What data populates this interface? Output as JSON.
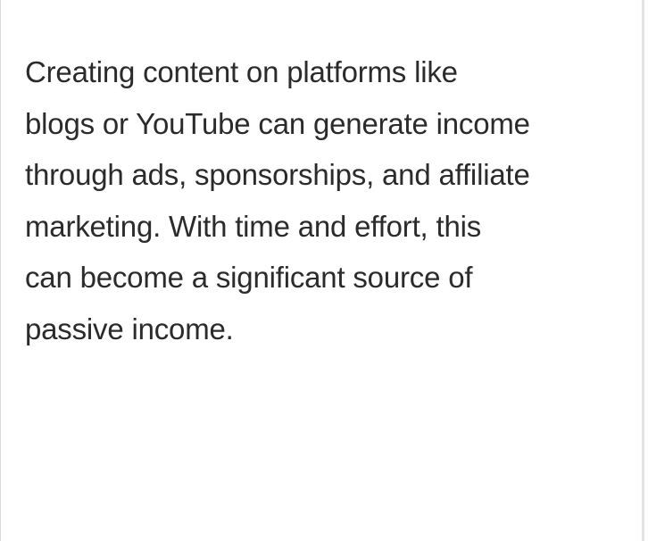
{
  "content": {
    "lines": [
      "Creating content on platforms like",
      "blogs or YouTube can generate income",
      "through ads, sponsorships, and affiliate",
      "marketing. With time and effort, this",
      "can become a significant source of",
      "passive income."
    ]
  }
}
